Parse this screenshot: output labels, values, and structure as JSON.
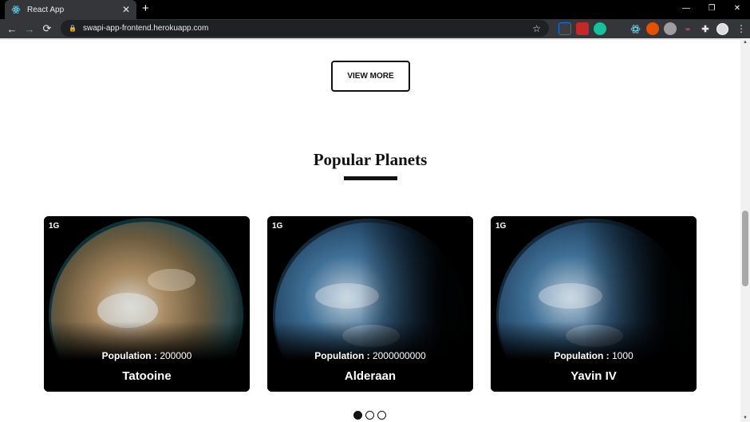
{
  "browser": {
    "tab_title": "React App",
    "tab_close": "✕",
    "new_tab": "+",
    "url": "swapi-app-frontend.herokuapp.com",
    "back": "←",
    "forward": "→",
    "reload": "⟳",
    "minimize": "—",
    "restore": "❐",
    "close": "✕",
    "menu": "⋮"
  },
  "page": {
    "view_more_label": "VIEW MORE",
    "section_title": "Popular Planets",
    "cards": [
      {
        "res": "1G",
        "pop_label": "Population :",
        "pop_value": "200000",
        "name": "Tatooine"
      },
      {
        "res": "1G",
        "pop_label": "Population :",
        "pop_value": "2000000000",
        "name": "Alderaan"
      },
      {
        "res": "1G",
        "pop_label": "Population :",
        "pop_value": "1000",
        "name": "Yavin IV"
      }
    ]
  },
  "colors": {
    "chrome_bg": "#35363a",
    "page_bg": "#ffffff",
    "card_bg": "#000000",
    "text_dark": "#111111"
  }
}
